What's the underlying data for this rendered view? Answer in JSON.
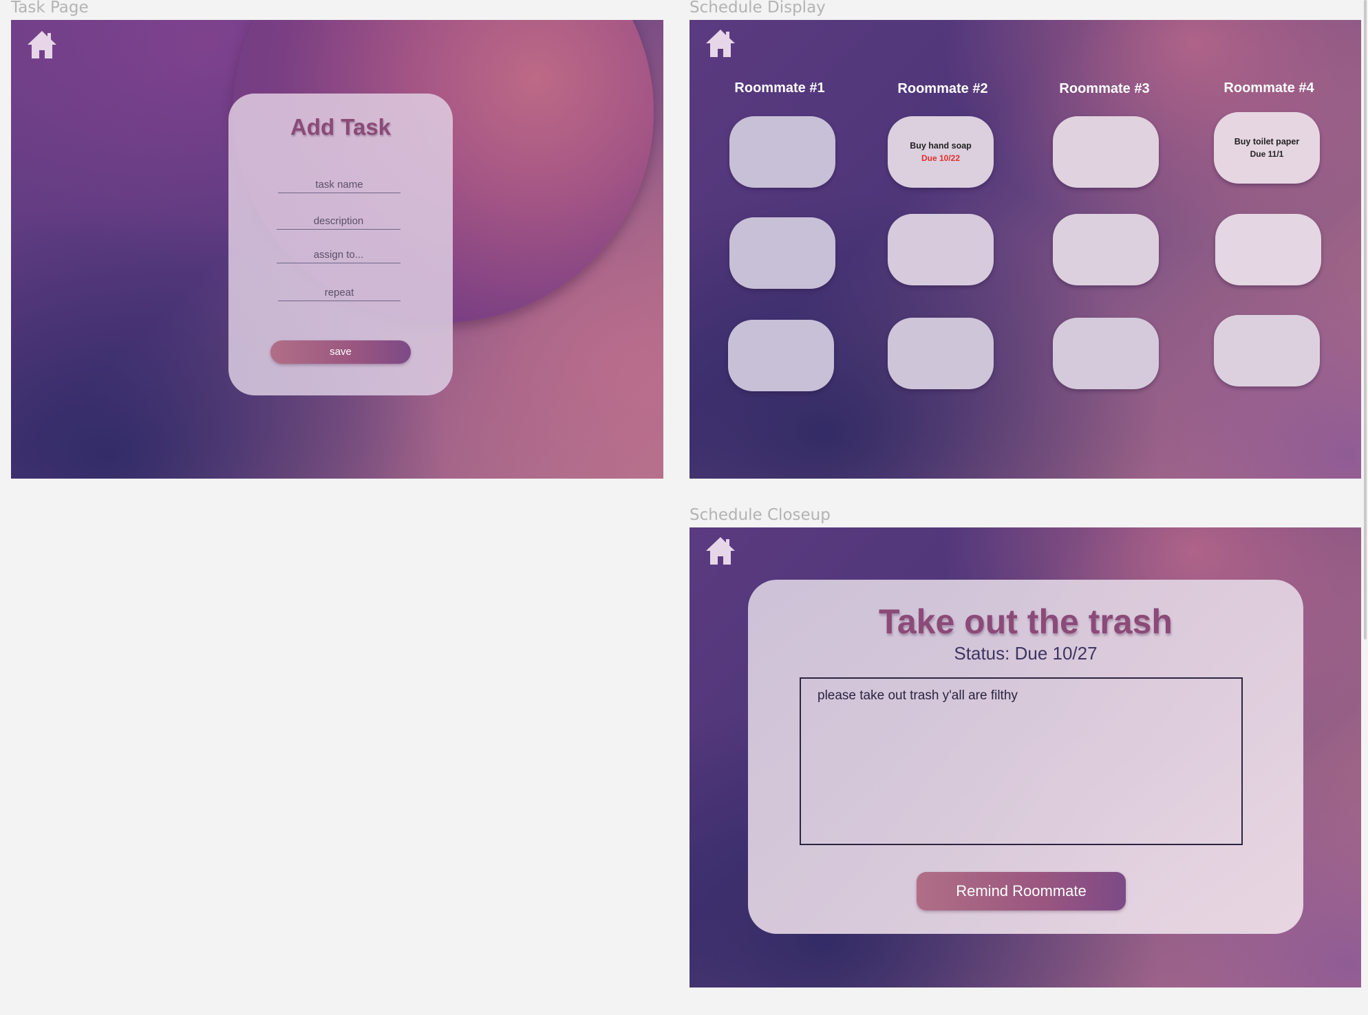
{
  "frames": {
    "task_page": "Task Page",
    "schedule_display": "Schedule Display",
    "schedule_closeup": "Schedule Closeup"
  },
  "icons": {
    "home": "home-icon"
  },
  "colors": {
    "title_mauve": "#8b4a78",
    "due_red": "#e0302a",
    "button_start": "#b06f86",
    "button_end": "#7c4a86"
  },
  "add_task": {
    "title": "Add Task",
    "fields": {
      "task_name": "task name",
      "description": "description",
      "assign_to": "assign to...",
      "repeat": "repeat"
    },
    "save_label": "save"
  },
  "schedule": {
    "roommates": [
      "Roommate #1",
      "Roommate #2",
      "Roommate #3",
      "Roommate #4"
    ],
    "tasks": {
      "rm2_row1": {
        "name": "Buy hand soap",
        "due": "Due 10/22",
        "overdue": true
      },
      "rm4_row1": {
        "name": "Buy toilet paper",
        "due": "Due 11/1",
        "overdue": false
      }
    }
  },
  "closeup": {
    "title": "Take out the trash",
    "status": "Status: Due 10/27",
    "description": "please take out trash y'all are filthy",
    "remind_label": "Remind Roommate"
  }
}
